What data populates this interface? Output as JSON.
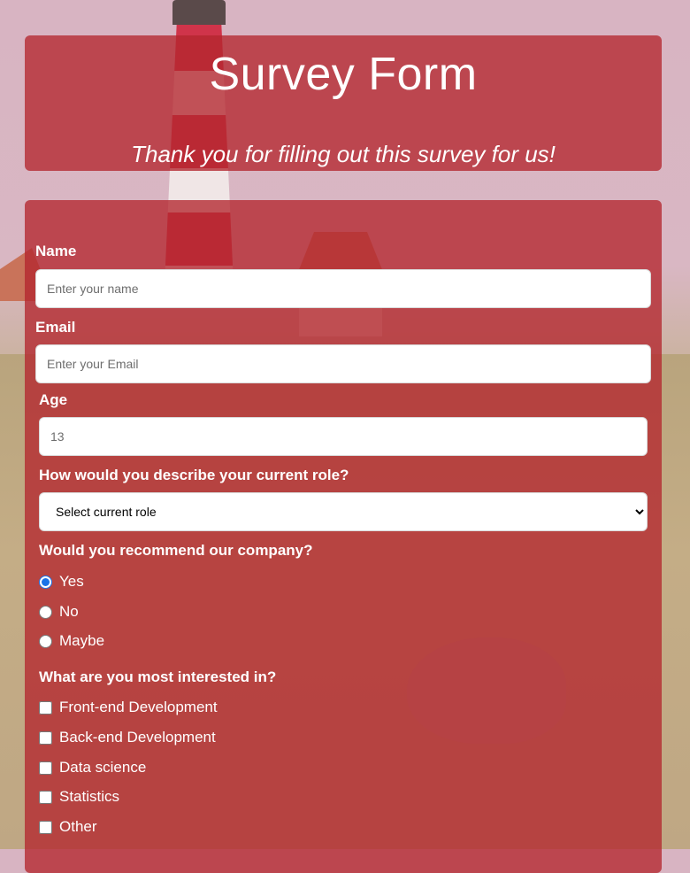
{
  "header": {
    "title": "Survey Form",
    "subtitle": "Thank you for filling out this survey for us!"
  },
  "form": {
    "name": {
      "label": "Name",
      "placeholder": "Enter your name",
      "value": ""
    },
    "email": {
      "label": "Email",
      "placeholder": "Enter your Email",
      "value": ""
    },
    "age": {
      "label": "Age",
      "placeholder": "13",
      "value": ""
    },
    "role": {
      "label": "How would you describe your current role?",
      "selected": "Select current role"
    },
    "recommend": {
      "label": "Would you recommend our company?",
      "options": [
        "Yes",
        "No",
        "Maybe"
      ],
      "selected": "Yes"
    },
    "interests": {
      "label": "What are you most interested in?",
      "options": [
        "Front-end Development",
        "Back-end Development",
        "Data science",
        "Statistics",
        "Other"
      ],
      "checked": []
    }
  },
  "theme": {
    "panel_color": "#b3262e",
    "text_color": "#ffffff",
    "radio_accent": "#1a73e8"
  }
}
